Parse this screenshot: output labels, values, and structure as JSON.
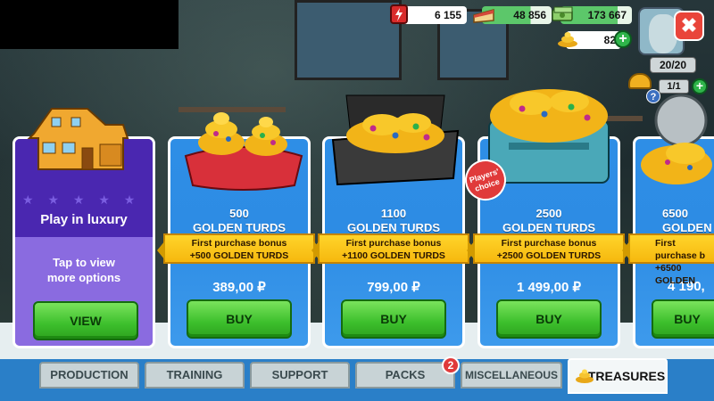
{
  "resources": {
    "energy": "6 155",
    "cake": "48 856",
    "money": "173 667",
    "golden_turds": "82"
  },
  "status": {
    "capacity": "20/20",
    "workers": "1/1",
    "help": "?"
  },
  "close": "✖",
  "luxury_card": {
    "heading": "Play in luxury",
    "description": "Tap to view more options",
    "button": "VIEW"
  },
  "offers": [
    {
      "amount": "500",
      "unit": "GOLDEN TURDS",
      "bonus_title": "First purchase bonus",
      "bonus_amount": "+500 GOLDEN TURDS",
      "price": "389,00 ₽",
      "button": "BUY"
    },
    {
      "amount": "1100",
      "unit": "GOLDEN TURDS",
      "bonus_title": "First purchase bonus",
      "bonus_amount": "+1100 GOLDEN TURDS",
      "price": "799,00 ₽",
      "button": "BUY"
    },
    {
      "amount": "2500",
      "unit": "GOLDEN TURDS",
      "bonus_title": "First purchase bonus",
      "bonus_amount": "+2500 GOLDEN TURDS",
      "price": "1 499,00 ₽",
      "button": "BUY",
      "badge": "Players' choice"
    },
    {
      "amount": "6500",
      "unit": "GOLDEN T",
      "bonus_title": "First purchase b",
      "bonus_amount": "+6500 GOLDEN",
      "price": "4 190,",
      "button": "BUY"
    }
  ],
  "tabs": [
    {
      "label": "PRODUCTION"
    },
    {
      "label": "TRAINING"
    },
    {
      "label": "SUPPORT"
    },
    {
      "label": "PACKS",
      "badge": "2"
    },
    {
      "label": "MISCELLANEOUS"
    },
    {
      "label": "TREASURES",
      "active": true
    }
  ],
  "colors": {
    "accent_green": "#3cbf2c",
    "card_blue": "#2e8ee6",
    "card_purple": "#5a36c8",
    "bonus_yellow": "#ffd42a"
  }
}
